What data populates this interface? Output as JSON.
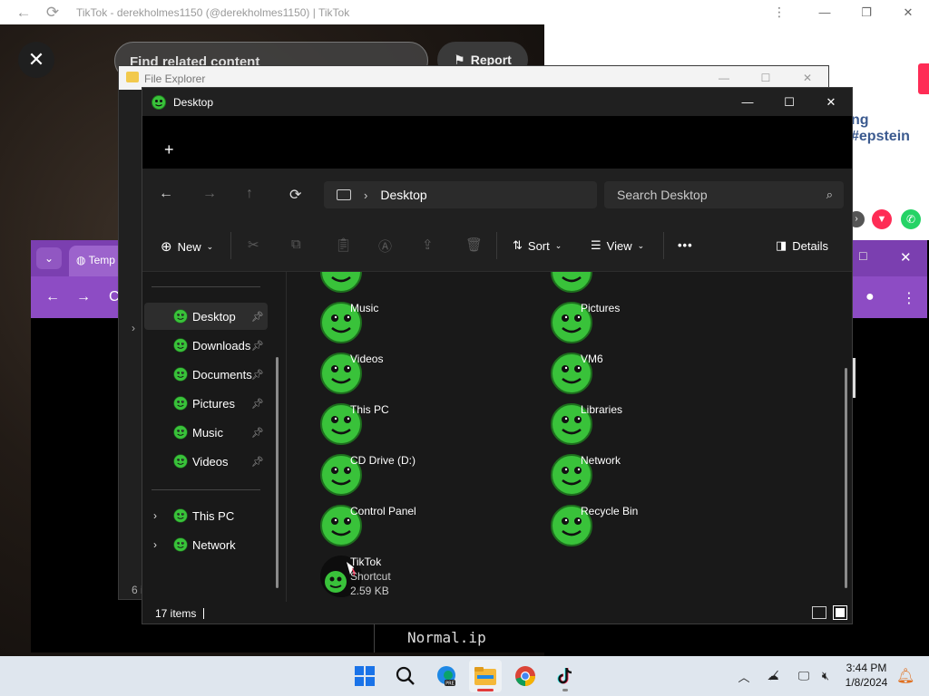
{
  "tiktok": {
    "title": "TikTok - derekholmes1150 (@derekholmes1150) | TikTok",
    "search_placeholder": "Find related content",
    "report_label": "Report",
    "hashtag_text": "ng #epstein",
    "close_glyph": "✕"
  },
  "purple_browser": {
    "tab_title": "Temp",
    "console_text": "Normal.ip"
  },
  "old_explorer": {
    "title": "File Explorer",
    "status_fragment": "6 i"
  },
  "explorer": {
    "title": "Desktop",
    "new_tab_glyph": "+",
    "path_segment": "Desktop",
    "search_placeholder": "Search Desktop",
    "commands": {
      "new": "New",
      "sort": "Sort",
      "view": "View",
      "more": "•••",
      "details": "Details"
    },
    "nav_pinned": [
      {
        "label": "Desktop",
        "selected": true
      },
      {
        "label": "Downloads"
      },
      {
        "label": "Documents"
      },
      {
        "label": "Pictures"
      },
      {
        "label": "Music"
      },
      {
        "label": "Videos"
      }
    ],
    "nav_locations": [
      {
        "label": "This PC"
      },
      {
        "label": "Network"
      }
    ],
    "items": [
      {
        "name": "Music"
      },
      {
        "name": "Pictures"
      },
      {
        "name": "Videos"
      },
      {
        "name": "VM6"
      },
      {
        "name": "This PC"
      },
      {
        "name": "Libraries"
      },
      {
        "name": "CD Drive (D:)"
      },
      {
        "name": "Network"
      },
      {
        "name": "Control Panel"
      },
      {
        "name": "Recycle Bin"
      },
      {
        "name": "TikTok",
        "type": "Shortcut",
        "size": "2.59 KB"
      }
    ],
    "status": "17 items",
    "colors": {
      "icon_green": "#39c23a",
      "background": "#191919"
    }
  },
  "taskbar": {
    "time": "3:44 PM",
    "date": "1/8/2024",
    "apps": [
      "windows-start-icon",
      "search-icon",
      "edge-dev-icon",
      "file-explorer-icon",
      "chrome-icon",
      "tiktok-icon"
    ]
  }
}
